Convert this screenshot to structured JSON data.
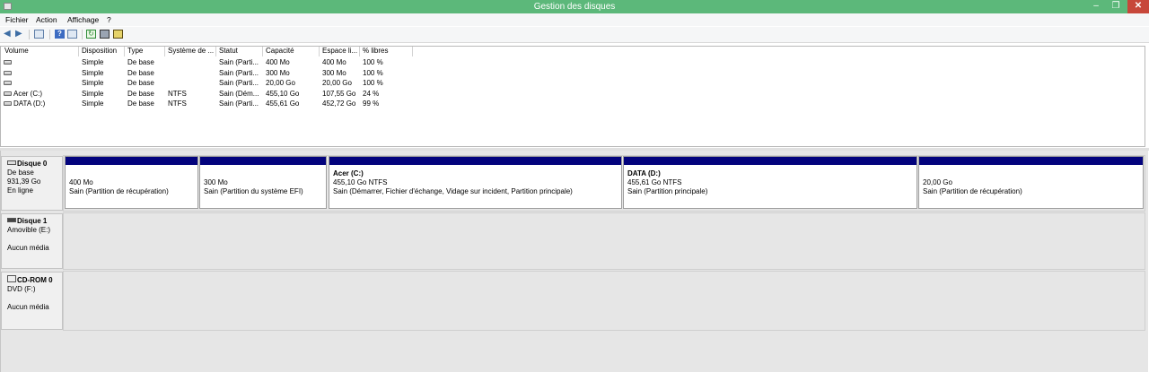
{
  "window": {
    "title": "Gestion des disques"
  },
  "menu": [
    "Fichier",
    "Action",
    "Affichage",
    "?"
  ],
  "toolbar_icons": [
    "back-arrow-icon",
    "forward-arrow-icon",
    "console-view-icon",
    "help-icon",
    "properties-icon",
    "refresh-icon",
    "rescan-icon",
    "settings-icon"
  ],
  "table": {
    "columns": [
      "Volume",
      "Disposition",
      "Type",
      "Système de ...",
      "Statut",
      "Capacité",
      "Espace li...",
      "% libres"
    ],
    "rows": [
      [
        "",
        "Simple",
        "De base",
        "",
        "Sain (Parti...",
        "400 Mo",
        "400 Mo",
        "100 %"
      ],
      [
        "",
        "Simple",
        "De base",
        "",
        "Sain (Parti...",
        "300 Mo",
        "300 Mo",
        "100 %"
      ],
      [
        "",
        "Simple",
        "De base",
        "",
        "Sain (Parti...",
        "20,00 Go",
        "20,00 Go",
        "100 %"
      ],
      [
        "Acer (C:)",
        "Simple",
        "De base",
        "NTFS",
        "Sain (Dém...",
        "455,10 Go",
        "107,55 Go",
        "24 %"
      ],
      [
        "DATA (D:)",
        "Simple",
        "De base",
        "NTFS",
        "Sain (Parti...",
        "455,61 Go",
        "452,72 Go",
        "99 %"
      ]
    ]
  },
  "disks": [
    {
      "name": "Disque 0",
      "lines": [
        "De base",
        "931,39 Go",
        "En ligne"
      ],
      "partitions": [
        {
          "name": "",
          "size": "400 Mo",
          "status": "Sain (Partition de récupération)"
        },
        {
          "name": "",
          "size": "300 Mo",
          "status": "Sain (Partition du système EFI)"
        },
        {
          "name": "Acer  (C:)",
          "size": "455,10 Go NTFS",
          "status": "Sain (Démarrer, Fichier d'échange, Vidage sur incident, Partition principale)"
        },
        {
          "name": "DATA  (D:)",
          "size": "455,61 Go NTFS",
          "status": "Sain (Partition principale)"
        },
        {
          "name": "",
          "size": "20,00 Go",
          "status": "Sain (Partition de récupération)"
        }
      ]
    },
    {
      "name": "Disque 1",
      "lines": [
        "Amovible (E:)",
        "",
        "Aucun média"
      ]
    },
    {
      "name": "CD-ROM 0",
      "lines": [
        "DVD (F:)",
        "",
        "Aucun média"
      ]
    }
  ],
  "colors": {
    "titlebar": "#5cb87a",
    "partition_bar": "#03037d",
    "close": "#c7473a"
  }
}
